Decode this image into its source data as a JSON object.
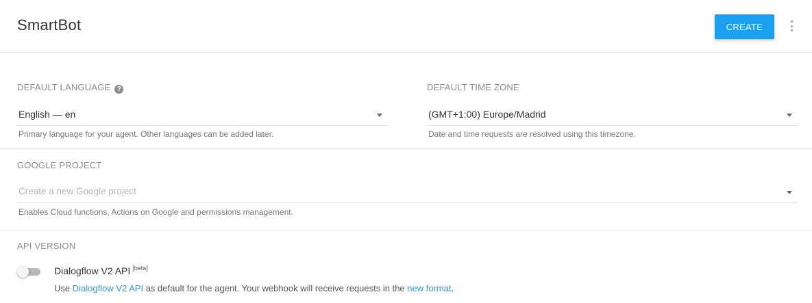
{
  "header": {
    "agent_name": "SmartBot",
    "create_label": "CREATE",
    "more_icon": "more-vertical-icon"
  },
  "default_language": {
    "label": "DEFAULT LANGUAGE",
    "help_icon": "?",
    "value": "English — en",
    "hint": "Primary language for your agent. Other languages can be added later."
  },
  "default_time_zone": {
    "label": "DEFAULT TIME ZONE",
    "value": "(GMT+1:00) Europe/Madrid",
    "hint": "Date and time requests are resolved using this timezone."
  },
  "google_project": {
    "label": "GOOGLE PROJECT",
    "placeholder": "Create a new Google project",
    "hint": "Enables Cloud functions, Actions on Google and permissions management."
  },
  "api_version": {
    "label": "API VERSION",
    "toggle_on": false,
    "title": "Dialogflow V2 API",
    "badge": "[beta]",
    "desc_prefix": "Use ",
    "desc_link1": "Dialogflow V2 API",
    "desc_middle": " as default for the agent. Your webhook will receive requests in the ",
    "desc_link2": "new format",
    "desc_suffix": "."
  },
  "colors": {
    "accent": "#1aa0ee",
    "link": "#2e9bd6"
  }
}
